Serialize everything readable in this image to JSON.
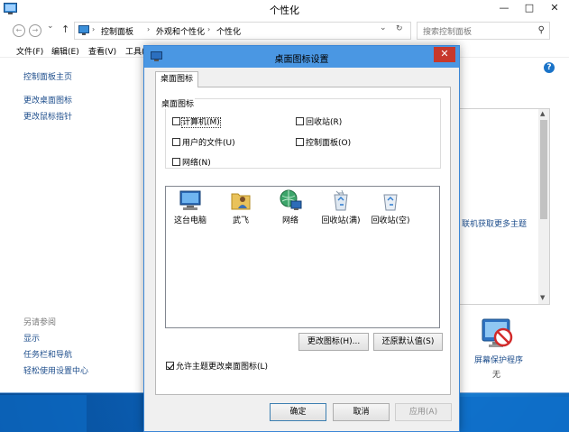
{
  "window": {
    "title": "个性化",
    "minimize": "—",
    "maximize": "□",
    "close": "✕"
  },
  "address": {
    "back": "←",
    "forward": "→",
    "up": "↑",
    "crumbs": [
      "控制面板",
      "外观和个性化",
      "个性化"
    ],
    "separator": "›",
    "dropdown": "⌄",
    "refresh": "↻",
    "search_placeholder": "搜索控制面板",
    "search_glyph": "⚲"
  },
  "menu": {
    "file": "文件(F)",
    "edit": "编辑(E)",
    "view": "查看(V)",
    "tools": "工具(T)"
  },
  "left_pane": {
    "home": "控制面板主页",
    "change_desktop_icons": "更改桌面图标",
    "change_mouse_pointer": "更改鼠标指针",
    "see_also": "另请参阅",
    "display": "显示",
    "taskbar_nav": "任务栏和导航",
    "ease_of_access": "轻松使用设置中心"
  },
  "right_pane": {
    "help_glyph": "?",
    "online_themes": "联机获取更多主题",
    "screensaver_label": "屏幕保护程序",
    "screensaver_value": "无"
  },
  "dialog": {
    "title": "桌面图标设置",
    "close": "✕",
    "tab": "桌面图标",
    "group_label": "桌面图标",
    "checkboxes": [
      {
        "label": "计算机(M)",
        "checked": false
      },
      {
        "label": "回收站(R)",
        "checked": false
      },
      {
        "label": "用户的文件(U)",
        "checked": false
      },
      {
        "label": "控制面板(O)",
        "checked": false
      },
      {
        "label": "网络(N)",
        "checked": false
      }
    ],
    "icons": [
      "这台电脑",
      "武飞",
      "网络",
      "回收站(满)",
      "回收站(空)"
    ],
    "change_icon": "更改图标(H)...",
    "restore_default": "还原默认值(S)",
    "allow_themes": "允许主题更改桌面图标(L)",
    "allow_themes_checked": true,
    "ok": "确定",
    "cancel": "取消",
    "apply": "应用(A)"
  },
  "colors": {
    "link": "#1e4e8c",
    "dialog_title": "#4a97e3",
    "close_red": "#c7382b"
  }
}
